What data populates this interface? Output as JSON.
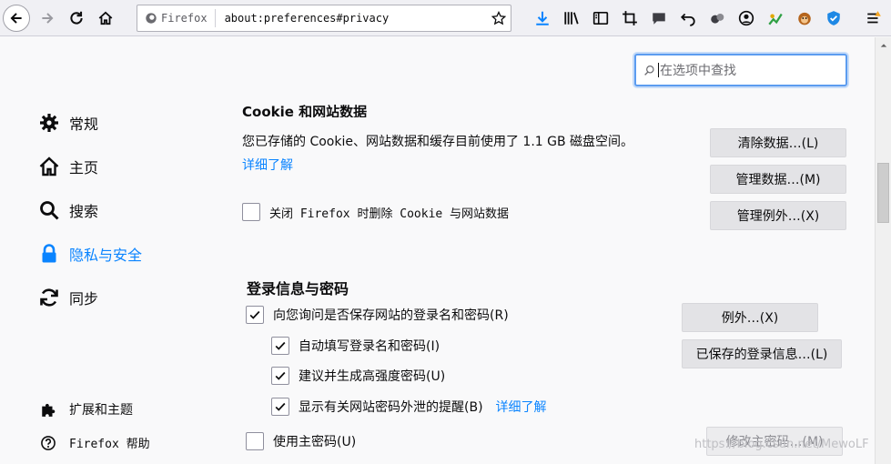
{
  "browser": {
    "identity_label": "Firefox",
    "url": "about:preferences#privacy"
  },
  "search": {
    "placeholder": "在选项中查找"
  },
  "sidebar": {
    "items": [
      {
        "label": "常规"
      },
      {
        "label": "主页"
      },
      {
        "label": "搜索"
      },
      {
        "label": "隐私与安全"
      },
      {
        "label": "同步"
      }
    ],
    "extensions_label": "扩展和主题",
    "help_label": "Firefox 帮助"
  },
  "cookies": {
    "heading_partial": "Cookie 和网站数据",
    "usage_text": "您已存储的 Cookie、网站数据和缓存目前使用了 1.1 GB 磁盘空间。",
    "learn_more": "详细了解",
    "clear_data_btn": "清除数据…(L)",
    "manage_data_btn": "管理数据…(M)",
    "manage_exceptions_btn": "管理例外…(X)",
    "delete_on_close_label": "关闭 Firefox 时删除 Cookie 与网站数据",
    "delete_on_close_checked": false
  },
  "logins": {
    "title": "登录信息与密码",
    "ask_save_label": "向您询问是否保存网站的登录名和密码(R)",
    "autofill_label": "自动填写登录名和密码(I)",
    "suggest_label": "建议并生成高强度密码(U)",
    "breach_label": "显示有关网站密码外泄的提醒(B)",
    "breach_learn_more": "详细了解",
    "master_password_label": "使用主密码(U)",
    "exceptions_btn": "例外…(X)",
    "saved_logins_btn": "已保存的登录信息…(L)",
    "change_master_btn": "修改主密码…(M)"
  },
  "watermark": "https://blog.csdn.net/MewoLF"
}
